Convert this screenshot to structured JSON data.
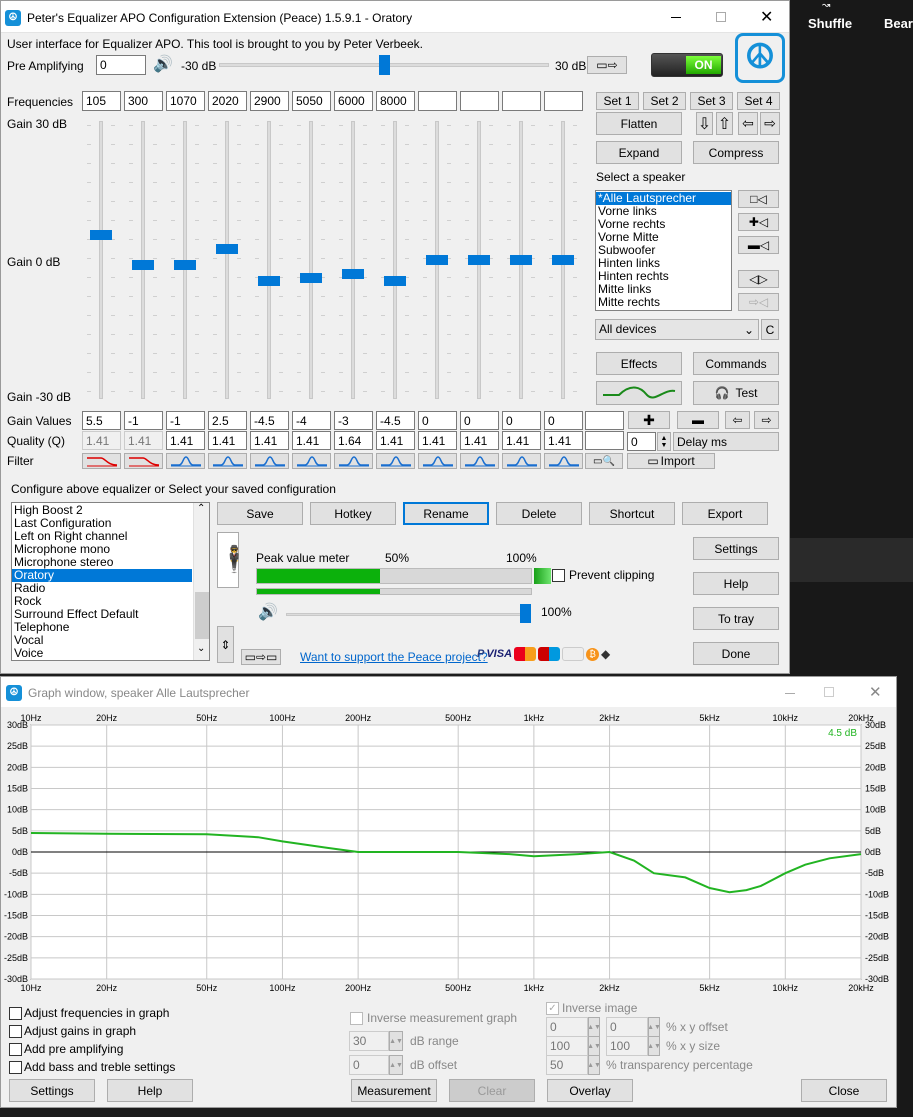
{
  "bg_app": {
    "items": [
      "Shuffle",
      "Bear"
    ]
  },
  "main": {
    "title": "Peter's Equalizer APO Configuration Extension (Peace) 1.5.9.1 - Oratory",
    "intro": "User interface for Equalizer APO. This tool is brought to you by Peter Verbeek.",
    "preamp": {
      "label": "Pre Amplifying",
      "value": "0",
      "min": "-30 dB",
      "max": "30 dB",
      "level": 0.5
    },
    "power": "ON",
    "freq_label": "Frequencies",
    "frequencies": [
      "105",
      "300",
      "1070",
      "2020",
      "2900",
      "5050",
      "6000",
      "8000",
      "",
      "",
      "",
      ""
    ],
    "sets": [
      "Set 1",
      "Set 2",
      "Set 3",
      "Set 4"
    ],
    "gain_top": "Gain 30 dB",
    "gain_mid": "Gain 0 dB",
    "gain_bot": "Gain -30 dB",
    "gains_db": [
      5.5,
      -1,
      -1,
      2.5,
      -4.5,
      -4,
      -3,
      -4.5,
      0,
      0,
      0,
      0
    ],
    "gv_label": "Gain Values",
    "gain_values": [
      "5.5",
      "-1",
      "-1",
      "2.5",
      "-4.5",
      "-4",
      "-3",
      "-4.5",
      "0",
      "0",
      "0",
      "0"
    ],
    "q_label": "Quality (Q)",
    "q_values": [
      "1.41",
      "1.41",
      "1.41",
      "1.41",
      "1.41",
      "1.41",
      "1.64",
      "1.41",
      "1.41",
      "1.41",
      "1.41",
      "1.41"
    ],
    "filter_label": "Filter",
    "flatten": "Flatten",
    "expand": "Expand",
    "compress": "Compress",
    "speaker_title": "Select a speaker",
    "speakers": [
      "*Alle Lautsprecher",
      "Vorne links",
      "Vorne rechts",
      "Vorne Mitte",
      "Subwoofer",
      "Hinten links",
      "Hinten rechts",
      "Mitte links",
      "Mitte rechts"
    ],
    "device": "All devices",
    "device_c": "C",
    "effects": "Effects",
    "commands": "Commands",
    "test": "Test",
    "delay_value": "0",
    "delay_label": "Delay ms",
    "import": "Import",
    "config_title": "Configure above equalizer or Select your saved configuration",
    "configs": [
      "High Boost 2",
      "Last Configuration",
      "Left on Right channel",
      "Microphone mono",
      "Microphone stereo",
      "Oratory",
      "Radio",
      "Rock",
      "Surround Effect Default",
      "Telephone",
      "Vocal",
      "Voice"
    ],
    "actions": [
      "Save",
      "Hotkey",
      "Rename",
      "Delete",
      "Shortcut",
      "Export"
    ],
    "peak_label": "Peak value meter",
    "peak_50": "50%",
    "peak_100": "100%",
    "peak_levels": [
      0.45,
      0.45
    ],
    "prevent_clipping": "Prevent clipping",
    "volume": "100%",
    "volume_level": 1.0,
    "support": "Want to support the Peace project?",
    "side_buttons": [
      "Settings",
      "Help",
      "To tray",
      "Done"
    ]
  },
  "graph": {
    "title": "Graph window, speaker Alle Lautsprecher",
    "x_ticks": [
      "10Hz",
      "20Hz",
      "50Hz",
      "100Hz",
      "200Hz",
      "500Hz",
      "1kHz",
      "2kHz",
      "5kHz",
      "10kHz",
      "20kHz"
    ],
    "y_ticks": [
      "30dB",
      "25dB",
      "20dB",
      "15dB",
      "10dB",
      "5dB",
      "0dB",
      "-5dB",
      "-10dB",
      "-15dB",
      "-20dB",
      "-25dB",
      "-30dB"
    ],
    "peak_label": "4.5 dB",
    "options": [
      "Adjust frequencies in graph",
      "Adjust gains in graph",
      "Add pre amplifying",
      "Add bass and treble settings"
    ],
    "inverse_measurement": "Inverse measurement graph",
    "inverse_image": "Inverse image",
    "db_range_value": "30",
    "db_range_label": "dB range",
    "db_offset_value": "0",
    "db_offset_label": "dB offset",
    "xy_offset": [
      "0",
      "0"
    ],
    "xy_offset_label": "% x y offset",
    "xy_size": [
      "100",
      "100"
    ],
    "xy_size_label": "% x y size",
    "transparency": "50",
    "transparency_label": "% transparency percentage",
    "buttons": [
      "Settings",
      "Help",
      "Measurement",
      "Clear",
      "Overlay",
      "Close"
    ],
    "curve_color": "#22b422"
  },
  "chart_data": {
    "type": "line",
    "title": "",
    "xlabel": "",
    "ylabel": "",
    "x_scale": "log",
    "xlim": [
      10,
      20000
    ],
    "ylim": [
      -30,
      30
    ],
    "grid": true,
    "series": [
      {
        "color": "#22b422",
        "x": [
          10,
          20,
          50,
          80,
          100,
          150,
          200,
          300,
          500,
          800,
          1000,
          1500,
          2000,
          2500,
          3000,
          4000,
          5000,
          6000,
          7000,
          8000,
          10000,
          12000,
          15000,
          20000
        ],
        "y": [
          4.5,
          4.3,
          4.2,
          3.5,
          2.5,
          1,
          0,
          0,
          0,
          -0.5,
          -1,
          -0.5,
          0,
          -2,
          -5,
          -6,
          -8.5,
          -9.5,
          -9,
          -8,
          -5,
          -3,
          -1.5,
          -0.5
        ]
      }
    ]
  }
}
